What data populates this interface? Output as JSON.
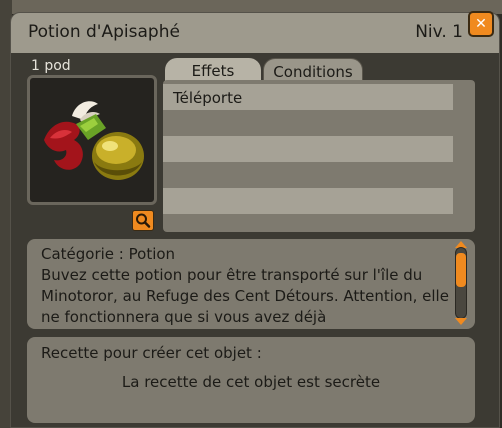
{
  "window": {
    "title": "Potion d'Apisaphé",
    "level": "Niv. 1",
    "close_icon": "close-icon",
    "accent_color": "#f08a1f"
  },
  "item": {
    "weight": "1 pod",
    "image_icon": "potion-item-icon",
    "zoom_icon": "magnifier-icon"
  },
  "tabs": {
    "effets": "Effets",
    "conditions": "Conditions",
    "selected": "Effets"
  },
  "effects": [
    "Téléporte"
  ],
  "description": {
    "text": "Catégorie : Potion\nBuvez cette potion pour être transporté sur l'île du Minotoror, au Refuge des Cent Détours. Attention, elle ne fonctionnera que si vous avez déjà",
    "scroll_position": 0
  },
  "recipe": {
    "title": "Recette pour créer cet objet :",
    "text": "La recette de cet objet est secrète"
  }
}
